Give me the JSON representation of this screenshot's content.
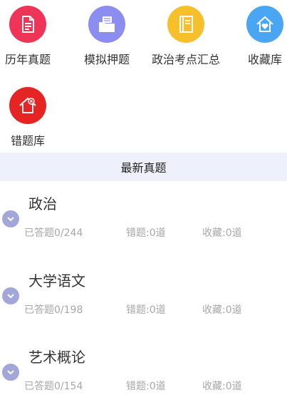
{
  "grid": {
    "items": [
      {
        "label": "历年真题",
        "icon": "document-icon",
        "color": "#ee3457"
      },
      {
        "label": "模拟押题",
        "icon": "folder-icon",
        "color": "#8b8ef0"
      },
      {
        "label": "政治考点汇总",
        "icon": "book-icon",
        "color": "#f6c02d"
      },
      {
        "label": "收藏库",
        "icon": "heart-house-icon",
        "color": "#4aa6f3"
      },
      {
        "label": "错题库",
        "icon": "error-house-icon",
        "color": "#e52424"
      }
    ]
  },
  "section": {
    "title": "最新真题"
  },
  "subjects": [
    {
      "title": "政治",
      "answered": "已答题0/244",
      "wrong": "错题:0道",
      "saved": "收藏:0道"
    },
    {
      "title": "大学语文",
      "answered": "已答题0/198",
      "wrong": "错题:0道",
      "saved": "收藏:0道"
    },
    {
      "title": "艺术概论",
      "answered": "已答题0/154",
      "wrong": "错题:0道",
      "saved": "收藏:0道"
    }
  ]
}
